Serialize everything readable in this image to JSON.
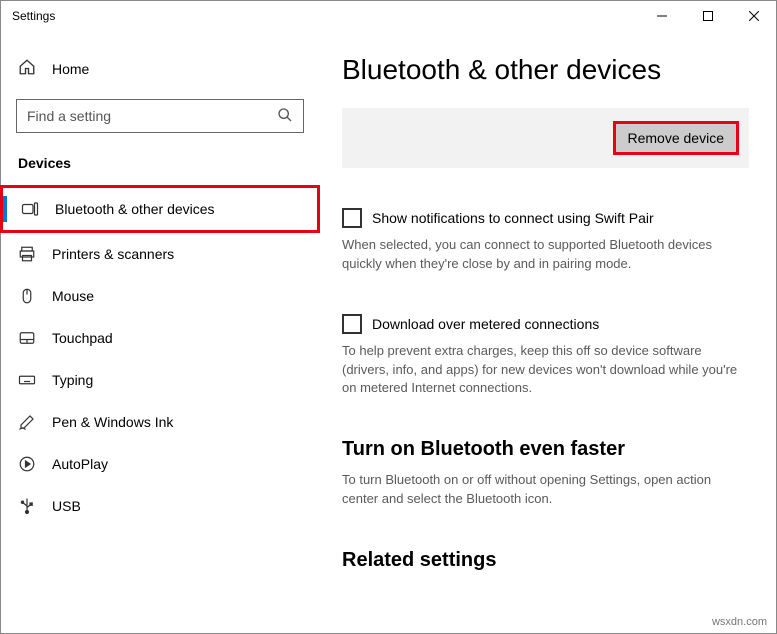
{
  "window": {
    "title": "Settings"
  },
  "sidebar": {
    "home": "Home",
    "search_placeholder": "Find a setting",
    "section": "Devices",
    "items": [
      "Bluetooth & other devices",
      "Printers & scanners",
      "Mouse",
      "Touchpad",
      "Typing",
      "Pen & Windows Ink",
      "AutoPlay",
      "USB"
    ]
  },
  "content": {
    "title": "Bluetooth & other devices",
    "remove_label": "Remove device",
    "swift_pair_label": "Show notifications to connect using Swift Pair",
    "swift_pair_desc": "When selected, you can connect to supported Bluetooth devices quickly when they're close by and in pairing mode.",
    "metered_label": "Download over metered connections",
    "metered_desc": "To help prevent extra charges, keep this off so device software (drivers, info, and apps) for new devices won't download while you're on metered Internet connections.",
    "faster_head": "Turn on Bluetooth even faster",
    "faster_desc": "To turn Bluetooth on or off without opening Settings, open action center and select the Bluetooth icon.",
    "related_head": "Related settings"
  },
  "watermark": "wsxdn.com"
}
